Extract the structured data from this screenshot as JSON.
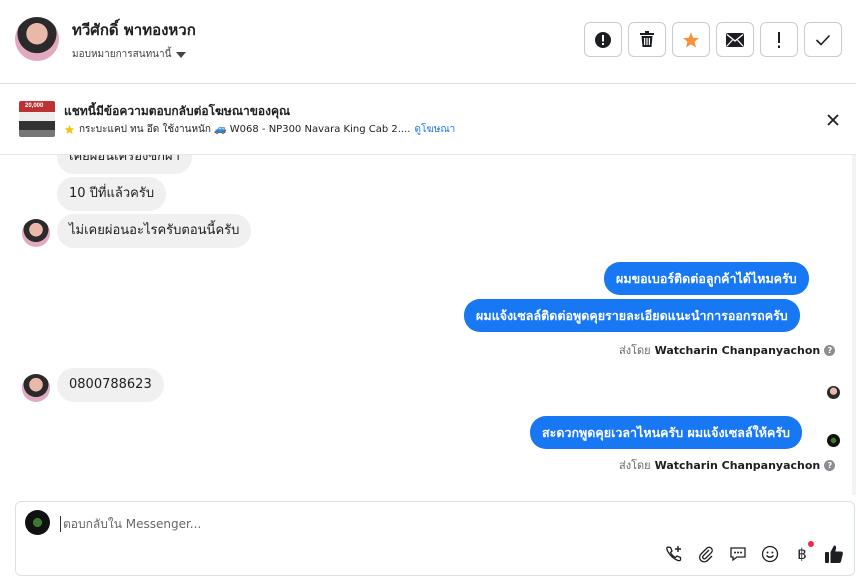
{
  "header": {
    "contact_name": "ทวีศักดิ์ พาทองหวก",
    "assign_label": "มอบหมายการสนทนานี้",
    "actions": [
      {
        "name": "report-button",
        "icon": "exclamation-circle-icon"
      },
      {
        "name": "delete-button",
        "icon": "trash-icon"
      },
      {
        "name": "star-button",
        "icon": "star-icon"
      },
      {
        "name": "mail-button",
        "icon": "envelope-icon"
      },
      {
        "name": "important-button",
        "icon": "exclamation-icon"
      },
      {
        "name": "done-button",
        "icon": "check-icon"
      }
    ],
    "star_color": "#f7923b"
  },
  "ad_banner": {
    "title": "แชทนี้มีข้อความตอบกลับต่อโฆษณาของคุณ",
    "subtitle": "กระบะแคป ทน อึด ใช้งานหนัก 🚙 W068 - NP300 Navara King Cab 2....",
    "link": "ดูโฆษณา",
    "thumb_text": "20,000"
  },
  "messages": {
    "in_1": "เคยผ่อนเครื่องซักผ้า",
    "in_2": "10 ปีที่แล้วครับ",
    "in_3": "ไม่เคยผ่อนอะไรครับตอนนี้ครับ",
    "out_1": "ผมขอเบอร์ติดต่อลูกค้าได้ไหมครับ",
    "out_2": "ผมแจ้งเซลล์ติดต่อพูดคุยรายละเอียดแนะนำการออกรถครับ",
    "sent_by_1_prefix": "ส่งโดย",
    "sent_by_1_name": "Watcharin Chanpanyachon",
    "in_4": "0800788623",
    "out_3": "สะดวกพูดคุยเวลาไหนครับ ผมแจ้งเซลล์ให้ครับ",
    "sent_by_2_prefix": "ส่งโดย",
    "sent_by_2_name": "Watcharin Chanpanyachon"
  },
  "composer": {
    "placeholder": "ตอบกลับใน Messenger...",
    "tools": [
      "add-call-icon",
      "paperclip-icon",
      "saved-reply-icon",
      "emoji-icon",
      "baht-icon",
      "like-icon"
    ]
  },
  "colors": {
    "accent": "#1877f2",
    "bubble_in": "#f0f0f0"
  }
}
